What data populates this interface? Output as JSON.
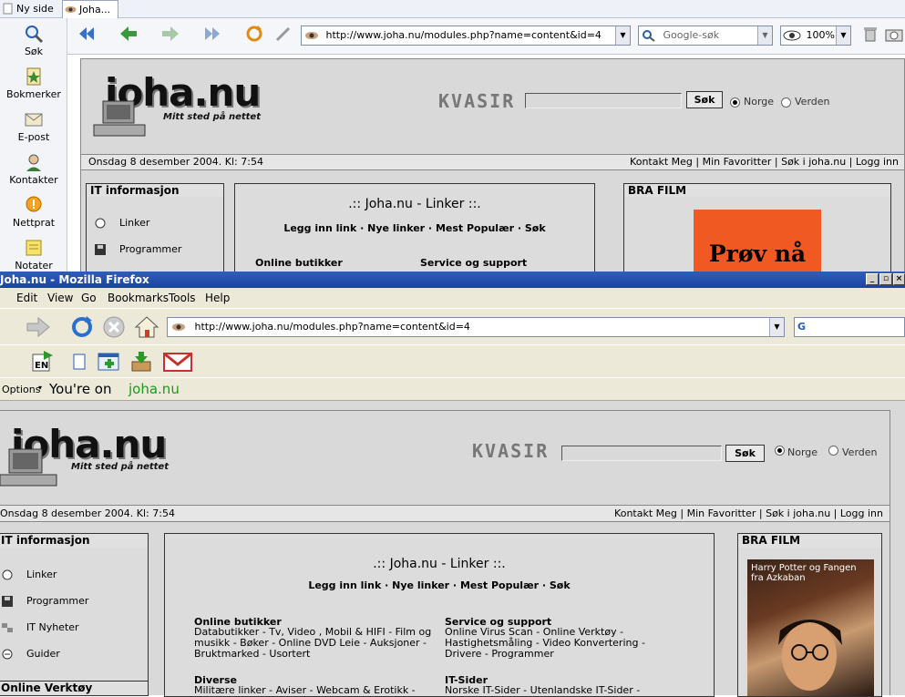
{
  "top_browser": {
    "tabs": [
      "Ny side",
      "Joha..."
    ],
    "sidebar": [
      {
        "label": "Søk",
        "icon": "search-icon"
      },
      {
        "label": "Bokmerker",
        "icon": "bookmarks-icon"
      },
      {
        "label": "E-post",
        "icon": "mail-icon"
      },
      {
        "label": "Kontakter",
        "icon": "contacts-icon"
      },
      {
        "label": "Nettprat",
        "icon": "chat-icon"
      },
      {
        "label": "Notater",
        "icon": "notes-icon"
      }
    ],
    "address": "http://www.joha.nu/modules.php?name=content&id=4",
    "search_placeholder": "Google-søk",
    "zoom": "100%"
  },
  "firefox": {
    "title": "Joha.nu - Mozilla Firefox",
    "menu": [
      "Edit",
      "View",
      "Go",
      "Bookmarks",
      "Tools",
      "Help"
    ],
    "address": "http://www.joha.nu/modules.php?name=content&id=4",
    "options_label": "Options",
    "youre_on_label": "You're on",
    "youre_on_site": "joha.nu"
  },
  "site": {
    "logo": "joha.nu",
    "tagline": "Mitt sted på nettet",
    "kvasir": "KVASIR",
    "search_button": "Søk",
    "radio_norge": "Norge",
    "radio_verden": "Verden",
    "date": "Onsdag 8 desember 2004. Kl: 7:54",
    "top_links": "Kontakt Meg | Min Favoritter | Søk i joha.nu | Logg inn",
    "left_box_title": "IT informasjon",
    "left_items": [
      "Linker",
      "Programmer",
      "IT Nyheter",
      "Guider"
    ],
    "left_box2_title": "Online Verktøy",
    "center_title": ".:: Joha.nu - Linker ::.",
    "center_links": "Legg inn link  ·  Nye linker  ·  Mest Populær  ·  Søk",
    "cat1_title": "Online butikker",
    "cat1_text": "Databutikker - Tv, Video , Mobil & HIFI - Film og musikk - Bøker - Online DVD Leie - Auksjoner - Bruktmarked - Usortert",
    "cat2_title": "Service og support",
    "cat2_text": "Online Virus Scan - Online Verktøy - Hastighetsmåling - Video Konvertering - Drivere - Programmer",
    "cat3_title": "Diverse",
    "cat3_text": "Militære linker - Aviser - Webcam & Erotikk -",
    "cat4_title": "IT-Sider",
    "cat4_text": "Norske IT-Sider - Utenlandske IT-Sider -",
    "right_box_title": "BRA FILM",
    "ad_text": "Prøv nå",
    "film_caption": "Harry Potter og Fangen fra Azkaban"
  }
}
